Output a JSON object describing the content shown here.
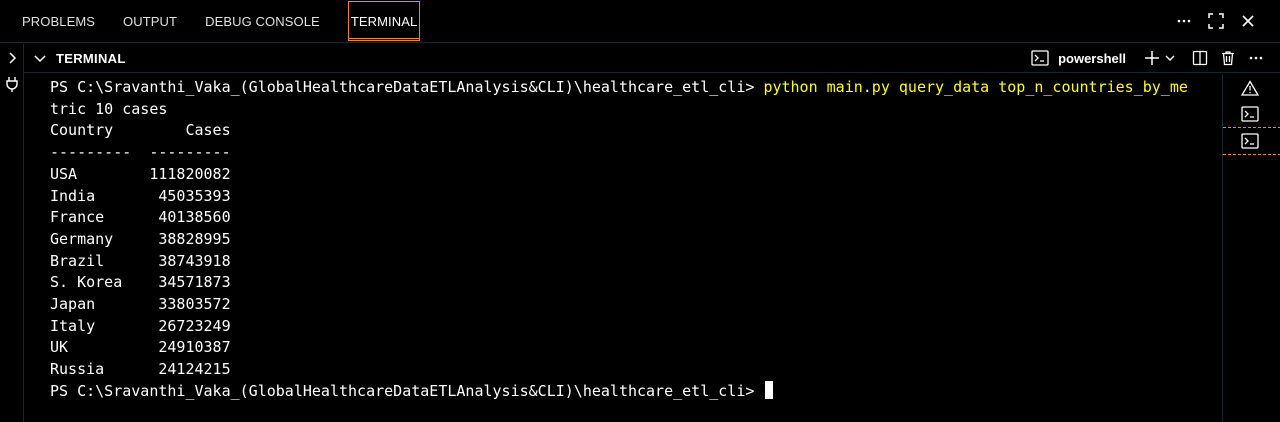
{
  "panel": {
    "tabs": [
      {
        "label": "PROBLEMS"
      },
      {
        "label": "OUTPUT"
      },
      {
        "label": "DEBUG CONSOLE"
      },
      {
        "label": "TERMINAL"
      }
    ],
    "active_tab": "TERMINAL"
  },
  "terminal": {
    "header_title": "TERMINAL",
    "shell_name": "powershell",
    "prompt": "PS C:\\Sravanthi_Vaka_(GlobalHealthcareDataETLAnalysis&CLI)\\healthcare_etl_cli> ",
    "command_part1": "python main.py query_data top_n_countries_by_me",
    "command_part2": "tric 10 cases",
    "table_header": "Country        Cases",
    "table_divider": "---------  ---------",
    "rows": [
      "USA        111820082",
      "India       45035393",
      "France      40138560",
      "Germany     38828995",
      "Brazil      38743918",
      "S. Korea    34571873",
      "Japan       33803572",
      "Italy       26723249",
      "UK          24910387",
      "Russia      24124215"
    ],
    "final_prompt": "PS C:\\Sravanthi_Vaka_(GlobalHealthcareDataETLAnalysis&CLI)\\healthcare_etl_cli> "
  },
  "colors": {
    "background": "#000000",
    "accent_border": "#f38518",
    "command_highlight": "#ffff00",
    "text": "#ffffff"
  },
  "icons": {
    "more": "ellipsis-icon",
    "maximize": "maximize-panel-icon",
    "close": "close-icon",
    "expand": "chevron-right-icon",
    "collapse": "chevron-down-icon",
    "plug": "plug-icon",
    "shell": "terminal-icon",
    "add": "plus-icon",
    "dropdown": "chevron-down-icon",
    "split": "split-terminal-icon",
    "trash": "trash-icon",
    "warning": "warning-icon"
  }
}
